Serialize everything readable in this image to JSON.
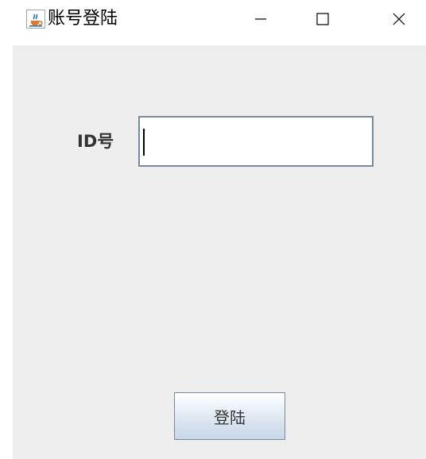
{
  "window": {
    "title": "账号登陆",
    "app_icon": "java-cup-icon",
    "controls": {
      "minimize": "minimize-icon",
      "maximize": "maximize-icon",
      "close": "close-icon"
    }
  },
  "form": {
    "id_label": "ID号",
    "id_value": "",
    "login_button_label": "登陆"
  },
  "colors": {
    "window_bg": "#ffffff",
    "panel_bg": "#eeeeee",
    "input_border": "#7a8a99",
    "button_gradient_top": "#ffffff",
    "button_gradient_bottom": "#c7d6e8"
  }
}
